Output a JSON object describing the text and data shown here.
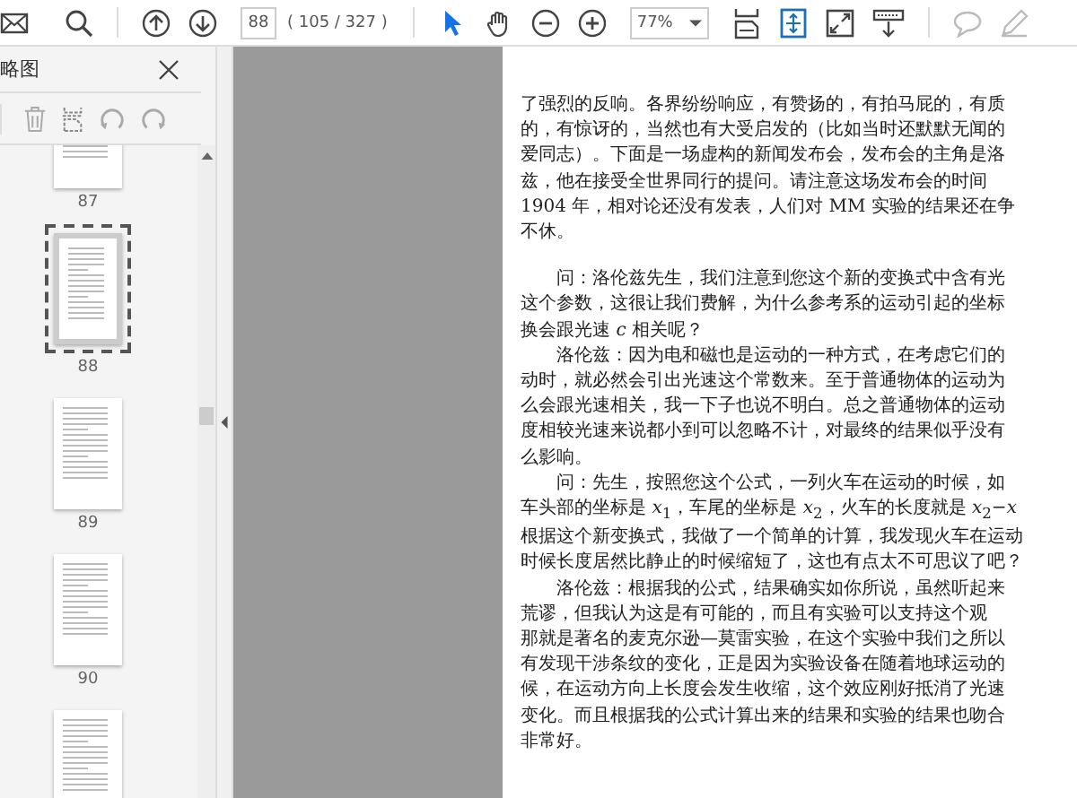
{
  "toolbar": {
    "page_field": {
      "value": "88"
    },
    "page_count": "( 105 / 327 )",
    "tools": [
      {
        "selected": true
      },
      {
        "selected": false
      }
    ],
    "zoom": {
      "value": "77%"
    },
    "comment": {
      "disabled": true
    },
    "sign": {
      "disabled": true
    }
  },
  "sidebar": {
    "title": "略图",
    "thumbnails": [
      {
        "label": "87",
        "selected": false
      },
      {
        "label": "88",
        "selected": true
      },
      {
        "label": "89",
        "selected": false
      },
      {
        "label": "90",
        "selected": false
      },
      {
        "selected": false
      }
    ]
  },
  "document": {
    "paragraphs": [
      {
        "lines": [
          "了强烈的反响。各界纷纷响应，有赞扬的，有拍马屁的，有质",
          "的，有惊讶的，当然也有大受启发的（比如当时还默默无闻的",
          "爱同志）。下面是一场虚构的新闻发布会，发布会的主角是洛",
          "兹，他在接受全世界同行的提问。请注意这场发布会的时间",
          "1904 年，相对论还没有发表，人们对 MM 实验的结果还在争",
          "不休。"
        ]
      },
      {
        "lines": [
          "　　问：洛伦兹先生，我们注意到您这个新的变换式中含有光",
          "这个参数，这很让我们费解，为什么参考系的运动引起的坐标",
          "换会跟光速 *c* 相关呢？"
        ]
      },
      {
        "lines": [
          "　　洛伦兹：因为电和磁也是运动的一种方式，在考虑它们的",
          "动时，就必然会引出光速这个常数来。至于普通物体的运动为",
          "么会跟光速相关，我一下子也说不明白。总之普通物体的运动",
          "度相较光速来说都小到可以忽略不计，对最终的结果似乎没有",
          "么影响。"
        ]
      },
      {
        "lines": [
          "　　问：先生，按照您这个公式，一列火车在运动的时候，如",
          "车头部的坐标是 *x*$_{1}$，车尾的坐标是 *x*$_{2}$，火车的长度就是 *x*$_{2}$−*x*",
          "根据这个新变换式，我做了一个简单的计算，我发现火车在运动",
          "时候长度居然比静止的时候缩短了，这也有点太不可思议了吧？"
        ]
      },
      {
        "lines": [
          "　　洛伦兹：根据我的公式，结果确实如你所说，虽然听起来",
          "荒谬，但我认为这是有可能的，而且有实验可以支持这个观",
          "那就是著名的麦克尔逊—莫雷实验，在这个实验中我们之所以",
          "有发现干涉条纹的变化，正是因为实验设备在随着地球运动的",
          "候，在运动方向上长度会发生收缩，这个效应刚好抵消了光速",
          "变化。而且根据我的公式计算出来的结果和实验的结果也吻合",
          "非常好。"
        ]
      }
    ]
  }
}
